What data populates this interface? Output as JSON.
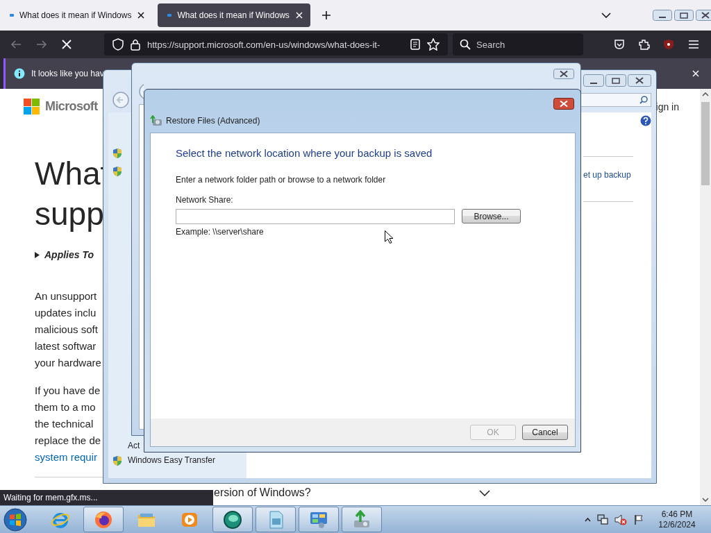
{
  "browser": {
    "tabs": [
      {
        "title": "What does it mean if Windows",
        "selected": false
      },
      {
        "title": "What does it mean if Windows",
        "selected": true
      }
    ],
    "url": "https://support.microsoft.com/en-us/windows/what-does-it-",
    "search": {
      "placeholder": "Search"
    },
    "notification": "It looks like you hav"
  },
  "page": {
    "logo": "Microsoft",
    "sign_in": "ign in",
    "heading": [
      "What",
      "supp"
    ],
    "applies_to": "Applies To",
    "paragraphs": [
      {
        "lines": [
          "An unsupport",
          "updates inclu",
          "malicious soft",
          "latest softwar",
          "your hardware"
        ]
      },
      {
        "lines": [
          "If you have de",
          "them to a mo",
          "the technical",
          "replace the de"
        ],
        "link": "system requir"
      }
    ],
    "faq": "ersion of Windows?"
  },
  "status": "Waiting for mem.gfx.ms...",
  "control_panel": {
    "link": "et up backup",
    "items": [
      {
        "label": "Act",
        "kind": "text"
      },
      {
        "label": "Windows Easy Transfer",
        "kind": "shield"
      }
    ]
  },
  "dialog": {
    "title": "Restore Files (Advanced)",
    "heading": "Select the network location where your backup is saved",
    "instruction": "Enter a network folder path or browse to a network folder",
    "field": {
      "label": "Network Share:"
    },
    "browse": "Browse...",
    "example": "Example: \\\\server\\share",
    "buttons": [
      {
        "label": "OK",
        "disabled": true
      },
      {
        "label": "Cancel",
        "disabled": false
      }
    ]
  },
  "taskbar": {
    "apps": [
      {
        "kind": "ie",
        "running": false
      },
      {
        "kind": "firefox",
        "running": true
      },
      {
        "kind": "explorer",
        "running": false
      },
      {
        "kind": "media",
        "running": false
      },
      {
        "kind": "sphere",
        "running": true
      },
      {
        "kind": "document",
        "running": true
      },
      {
        "kind": "control-panel",
        "running": true
      },
      {
        "kind": "backup",
        "running": true
      }
    ],
    "time": "6:46 PM",
    "date": "12/6/2024"
  }
}
